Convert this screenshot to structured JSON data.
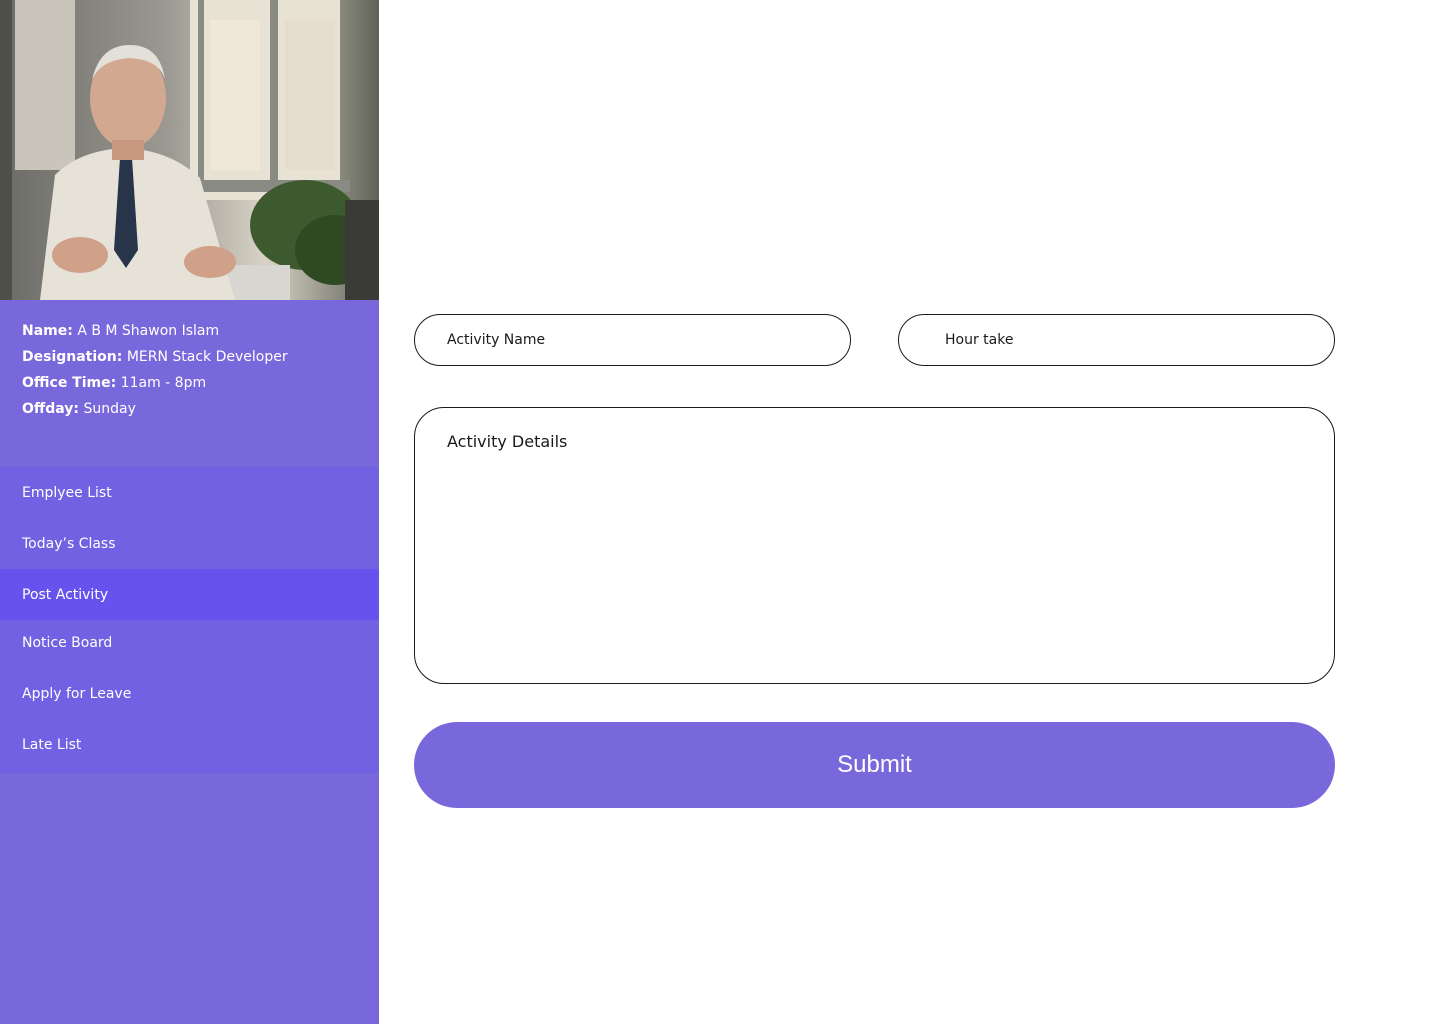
{
  "profile": {
    "name_label": "Name:",
    "name_value": "A B M Shawon Islam",
    "designation_label": "Designation:",
    "designation_value": "MERN Stack Developer",
    "office_time_label": "Office Time:",
    "office_time_value": "11am - 8pm",
    "offday_label": "Offday:",
    "offday_value": "Sunday"
  },
  "nav": {
    "items": [
      {
        "label": "Emplyee List",
        "active": false
      },
      {
        "label": "Today’s Class",
        "active": false
      },
      {
        "label": "Post Activity",
        "active": true
      },
      {
        "label": "Notice Board",
        "active": false
      },
      {
        "label": "Apply for Leave",
        "active": false
      },
      {
        "label": "Late List",
        "active": false
      }
    ]
  },
  "form": {
    "activity_name_placeholder": "Activity Name",
    "hour_take_placeholder": "Hour take",
    "activity_details_placeholder": "Activity Details",
    "submit_label": "Submit"
  },
  "colors": {
    "sidebar_bg": "#7868dc",
    "nav_bg": "#7261e2",
    "nav_active_bg": "#6852ee",
    "submit_bg": "#7868dc"
  }
}
